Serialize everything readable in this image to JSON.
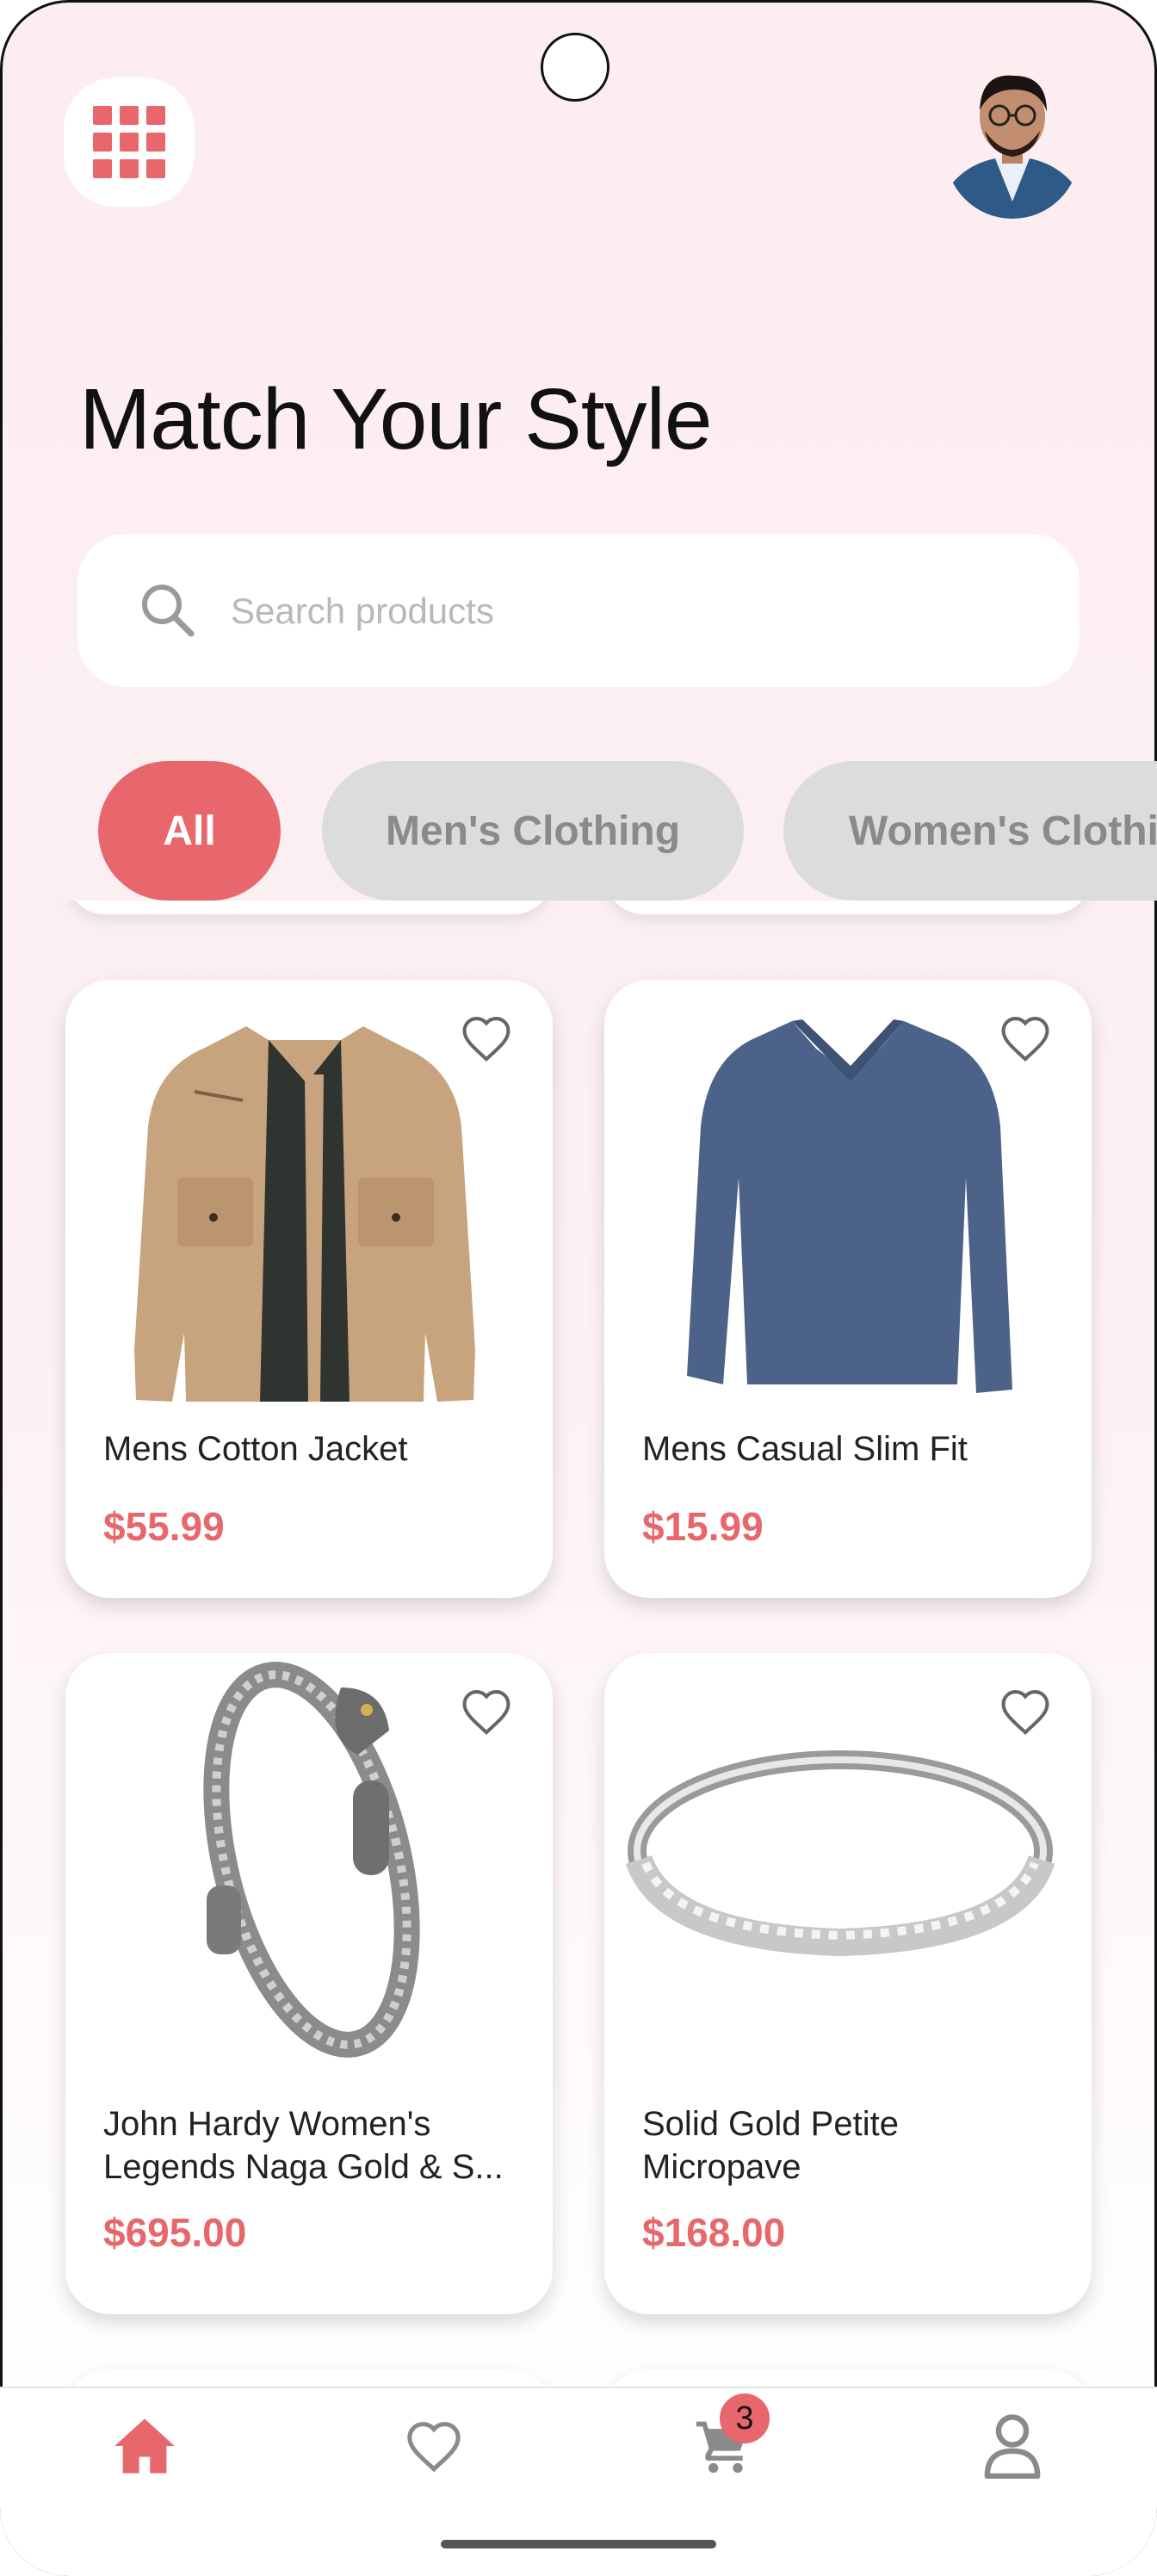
{
  "header": {
    "title": "Match Your Style",
    "menu_icon": "grid-menu-icon",
    "avatar_icon": "user-avatar"
  },
  "search": {
    "placeholder": "Search products",
    "icon": "search-icon"
  },
  "categories": [
    {
      "label": "All",
      "selected": true
    },
    {
      "label": "Men's Clothing",
      "selected": false
    },
    {
      "label": "Women's Clothing",
      "selected": false
    }
  ],
  "products": [
    {
      "name": "Mens Cotton Jacket",
      "price": "$55.99",
      "image": "jacket-image"
    },
    {
      "name": "Mens Casual Slim Fit",
      "price": "$15.99",
      "image": "tshirt-image"
    },
    {
      "name": "John Hardy Women's Legends Naga Gold & S...",
      "price": "$695.00",
      "image": "bracelet-image"
    },
    {
      "name": "Solid Gold Petite Micropave",
      "price": "$168.00",
      "image": "ring-image"
    }
  ],
  "bottom_nav": {
    "items": [
      "home-icon",
      "heart-icon",
      "cart-icon",
      "profile-icon"
    ],
    "cart_badge": "3"
  },
  "colors": {
    "accent": "#e8676c",
    "chip_inactive": "#dcdcdc",
    "background": "#fcedf0"
  }
}
